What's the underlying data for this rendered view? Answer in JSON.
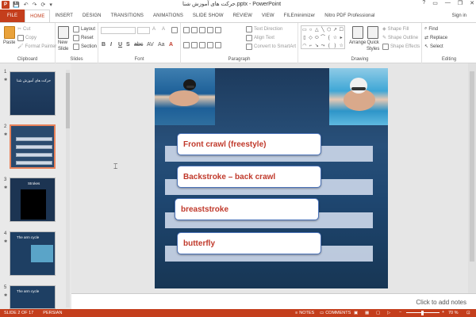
{
  "window": {
    "app_icon_letter": "P",
    "title": "حرکت های آموزش شنا.pptx - PowerPoint",
    "controls": [
      "?",
      "▭",
      "—",
      "❐",
      "✕"
    ]
  },
  "qat": [
    "💾",
    "↶",
    "↷",
    "⟳",
    "▾"
  ],
  "tabs": [
    "FILE",
    "HOME",
    "INSERT",
    "DESIGN",
    "TRANSITIONS",
    "ANIMATIONS",
    "SLIDE SHOW",
    "REVIEW",
    "VIEW",
    "FILEminimizer",
    "Nitro PDF Professional"
  ],
  "sign_in": "Sign in",
  "ribbon": {
    "clipboard": {
      "paste": "Paste",
      "cut": "Cut",
      "copy": "Copy",
      "format_painter": "Format Painter",
      "label": "Clipboard"
    },
    "slides": {
      "new_slide": "New",
      "new_slide2": "Slide",
      "layout": "Layout",
      "reset": "Reset",
      "section": "Section",
      "label": "Slides"
    },
    "font": {
      "label": "Font",
      "buttons": [
        "B",
        "I",
        "U",
        "S",
        "abc",
        "AV",
        "Aa",
        "A"
      ]
    },
    "paragraph": {
      "text_direction": "Text Direction",
      "align_text": "Align Text",
      "convert_smartart": "Convert to SmartArt",
      "label": "Paragraph"
    },
    "drawing": {
      "shapes": [
        "▭",
        "○",
        "△",
        "╲",
        "⬡",
        "↗",
        "☐",
        "▯",
        "◇",
        "⬭",
        "⌒",
        "{",
        "☆",
        "▸",
        "◠",
        "⌐",
        "↘",
        "⤳",
        "(",
        ")",
        "☆"
      ],
      "arrange": "Arrange",
      "quick_styles": "Quick",
      "quick_styles2": "Styles",
      "shape_fill": "Shape Fill",
      "shape_outline": "Shape Outline",
      "shape_effects": "Shape Effects",
      "label": "Drawing"
    },
    "editing": {
      "find": "Find",
      "replace": "Replace",
      "select": "Select",
      "label": "Editing"
    }
  },
  "thumbnails": [
    {
      "num": "1",
      "title": "حرکت های آموزش شنا"
    },
    {
      "num": "2",
      "title": ""
    },
    {
      "num": "3",
      "title": "Strokes"
    },
    {
      "num": "4",
      "title": "The arm cycle"
    },
    {
      "num": "5",
      "title": "The arm cycle"
    }
  ],
  "slide": {
    "strokes": [
      "Front crawl    (freestyle)",
      "Backstroke – back crawl",
      "breaststroke",
      "butterfly"
    ]
  },
  "notes_placeholder": "Click to add notes",
  "status": {
    "slide": "SLIDE 2 OF 17",
    "language": "PERSIAN",
    "notes": "NOTES",
    "comments": "COMMENTS",
    "zoom": "70 %"
  }
}
